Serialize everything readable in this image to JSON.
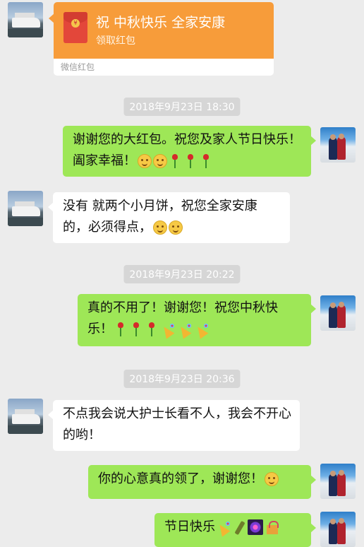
{
  "red_packet": {
    "title": "祝 中秋快乐 全家安康",
    "subtitle": "领取红包",
    "footer": "微信红包",
    "seal_char": "¥"
  },
  "timestamps": [
    "2018年9月23日 18:30",
    "2018年9月23日 20:22",
    "2018年9月23日 20:36"
  ],
  "messages": [
    {
      "side": "right",
      "text": "谢谢您的大红包。祝您及家人节日快乐！阖家幸福！",
      "emoji": [
        "smile",
        "smile",
        "rose",
        "rose",
        "rose"
      ]
    },
    {
      "side": "left",
      "text": "没有 就两个小月饼，祝您全家安康的，必须得点，",
      "emoji": [
        "smile",
        "smile"
      ]
    },
    {
      "side": "right",
      "text": "真的不用了！谢谢您！祝您中秋快乐！",
      "emoji": [
        "rose",
        "rose",
        "rose",
        "party",
        "party",
        "party"
      ]
    },
    {
      "side": "left",
      "text": "不点我会说大护士长看不人，我会不开心的哟！",
      "emoji": []
    },
    {
      "side": "right",
      "text": "你的心意真的领了，谢谢您！",
      "emoji": [
        "smile"
      ]
    },
    {
      "side": "right",
      "text": "节日快乐",
      "emoji": [
        "party",
        "bottle",
        "firework",
        "gift"
      ]
    }
  ],
  "colors": {
    "background": "#ececec",
    "bubble_self": "#9ee757",
    "bubble_other": "#ffffff",
    "red_packet": "#f79c3a",
    "timestamp_bg": "#d6d6d6"
  }
}
